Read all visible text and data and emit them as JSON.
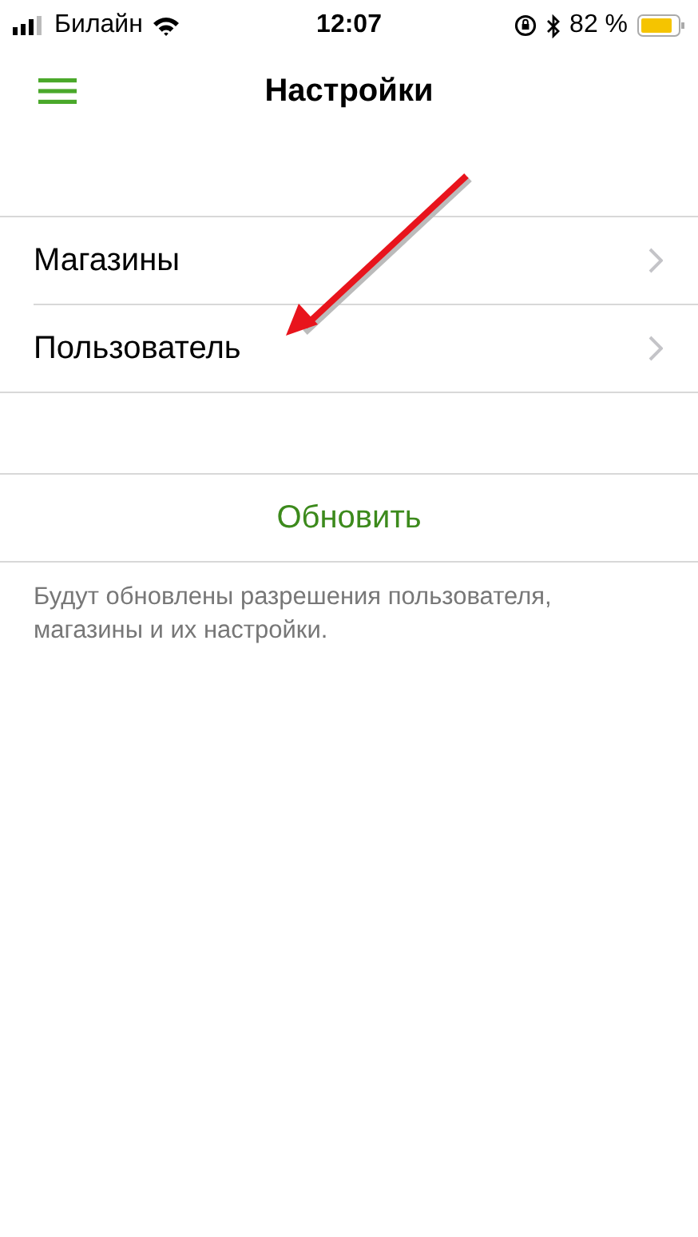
{
  "status_bar": {
    "carrier": "Билайн",
    "time": "12:07",
    "battery": "82 %"
  },
  "nav_bar": {
    "title": "Настройки"
  },
  "menu_items": [
    {
      "label": "Магазины"
    },
    {
      "label": "Пользователь"
    }
  ],
  "action": {
    "label": "Обновить"
  },
  "footnote": "Будут обновлены разрешения пользователя, магазины и их настройки."
}
